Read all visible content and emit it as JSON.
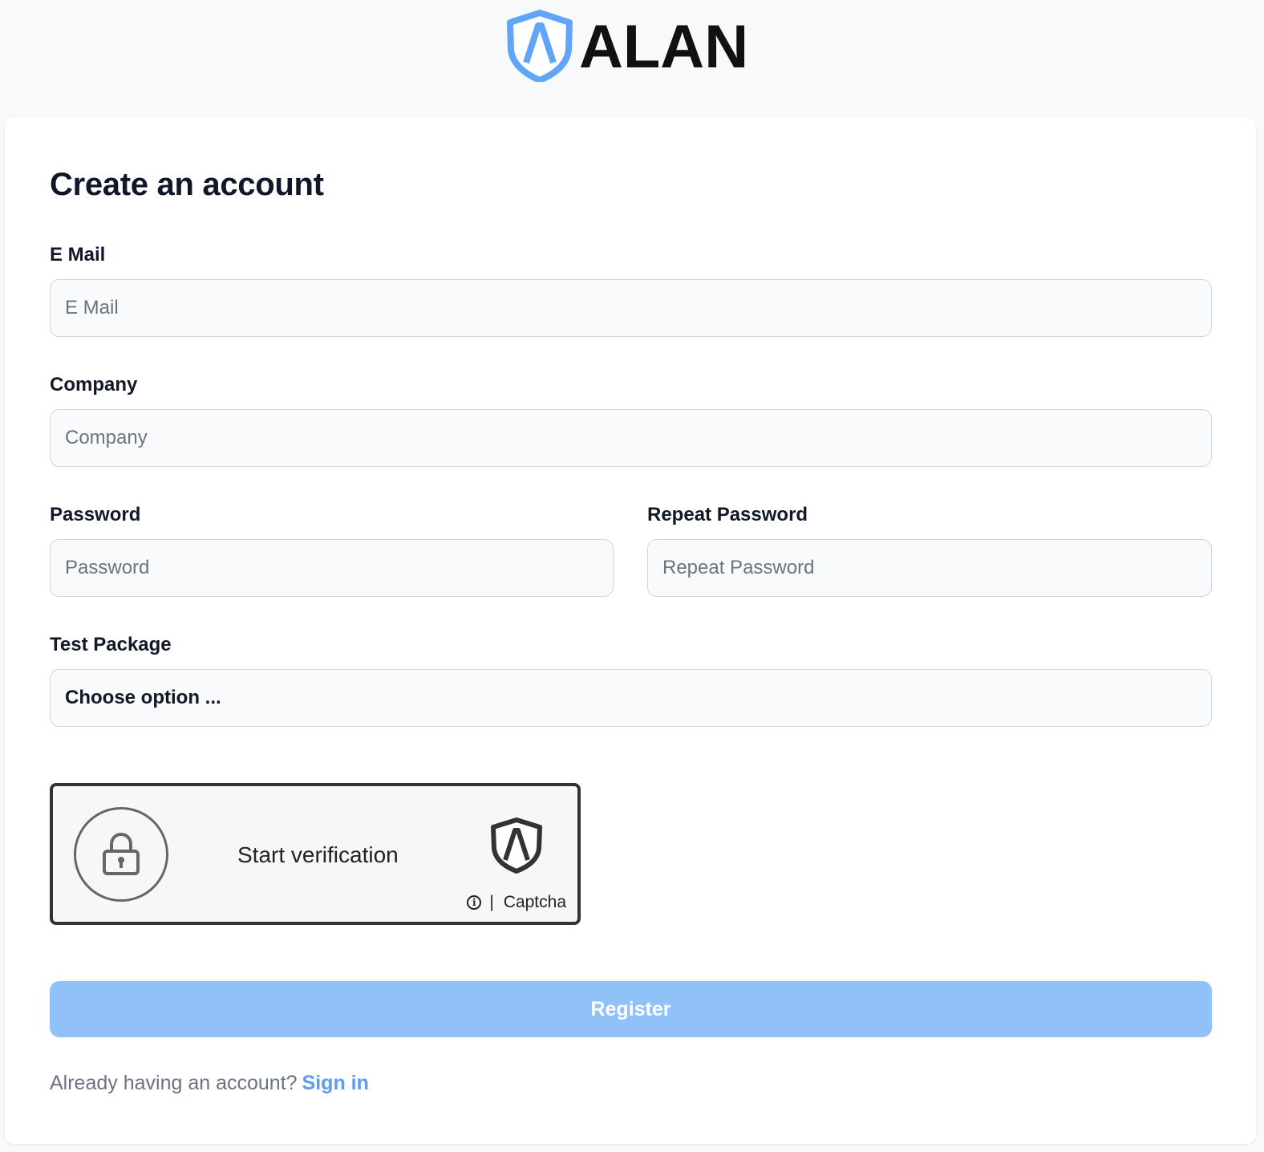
{
  "brand": {
    "name": "ALAN",
    "logo_color": "#60a5fa"
  },
  "form": {
    "title": "Create an account",
    "email": {
      "label": "E Mail",
      "placeholder": "E Mail",
      "value": ""
    },
    "company": {
      "label": "Company",
      "placeholder": "Company",
      "value": ""
    },
    "password": {
      "label": "Password",
      "placeholder": "Password",
      "value": ""
    },
    "repeat_password": {
      "label": "Repeat Password",
      "placeholder": "Repeat Password",
      "value": ""
    },
    "test_package": {
      "label": "Test Package",
      "selected": "Choose option ..."
    },
    "register_label": "Register",
    "register_color": "#90c1f9"
  },
  "captcha": {
    "action_text": "Start verification",
    "info_glyph": "i",
    "separator": "|",
    "brand_text": "Captcha",
    "lock_icon": "lock-icon",
    "shield_icon": "shield-icon"
  },
  "footer": {
    "prompt": "Already having an account?",
    "link_label": "Sign in",
    "link_color": "#5b9df3"
  }
}
